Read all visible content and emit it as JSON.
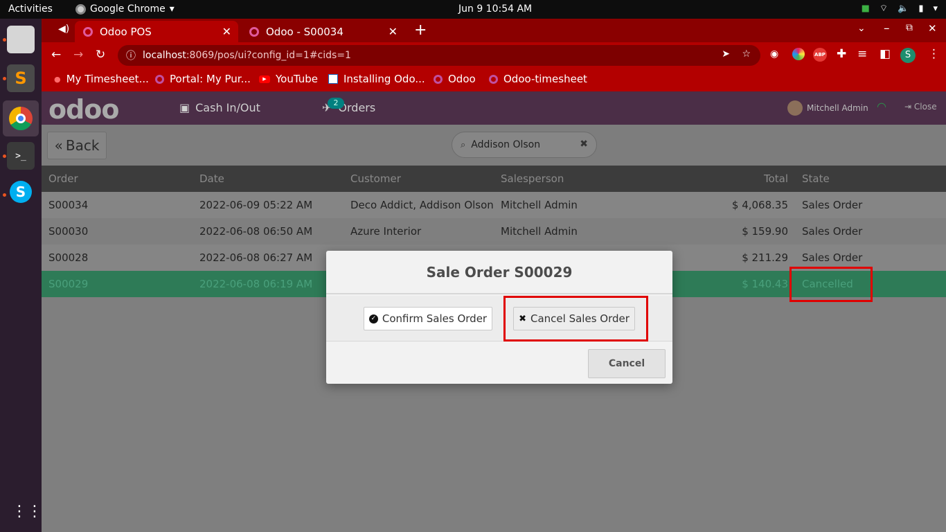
{
  "system": {
    "activities": "Activities",
    "app_name": "Google Chrome",
    "clock": "Jun 9  10:54 AM"
  },
  "browser": {
    "tabs": [
      {
        "title": "Odoo POS",
        "active": true
      },
      {
        "title": "Odoo - S00034",
        "active": false
      }
    ],
    "url_host": "localhost",
    "url_path": ":8069/pos/ui?config_id=1#cids=1",
    "profile_initial": "S",
    "extension_abp": "ABP",
    "bookmarks": [
      "My Timesheet...",
      "Portal: My Pur...",
      "YouTube",
      "Installing Odo...",
      "Odoo",
      "Odoo-timesheet"
    ]
  },
  "pos": {
    "logo": "odoo",
    "cash_label": "Cash In/Out",
    "orders_label": "Orders",
    "orders_badge": "2",
    "user": "Mitchell Admin",
    "close_label": "Close",
    "back_label": "Back",
    "search_value": "Addison Olson",
    "columns": {
      "order": "Order",
      "date": "Date",
      "customer": "Customer",
      "salesperson": "Salesperson",
      "total": "Total",
      "state": "State"
    },
    "rows": [
      {
        "order": "S00034",
        "date": "2022-06-09 05:22 AM",
        "customer": "Deco Addict, Addison Olson",
        "salesperson": "Mitchell Admin",
        "total": "$ 4,068.35",
        "state": "Sales Order"
      },
      {
        "order": "S00030",
        "date": "2022-06-08 06:50 AM",
        "customer": "Azure Interior",
        "salesperson": "Mitchell Admin",
        "total": "$ 159.90",
        "state": "Sales Order"
      },
      {
        "order": "S00028",
        "date": "2022-06-08 06:27 AM",
        "customer": "",
        "salesperson": "",
        "total": "$ 211.29",
        "state": "Sales Order"
      },
      {
        "order": "S00029",
        "date": "2022-06-08 06:19 AM",
        "customer": "",
        "salesperson": "",
        "total": "$ 140.43",
        "state": "Cancelled"
      }
    ]
  },
  "modal": {
    "title": "Sale Order S00029",
    "confirm_label": "Confirm Sales Order",
    "cancel_order_label": "Cancel Sales Order",
    "cancel_label": "Cancel"
  }
}
